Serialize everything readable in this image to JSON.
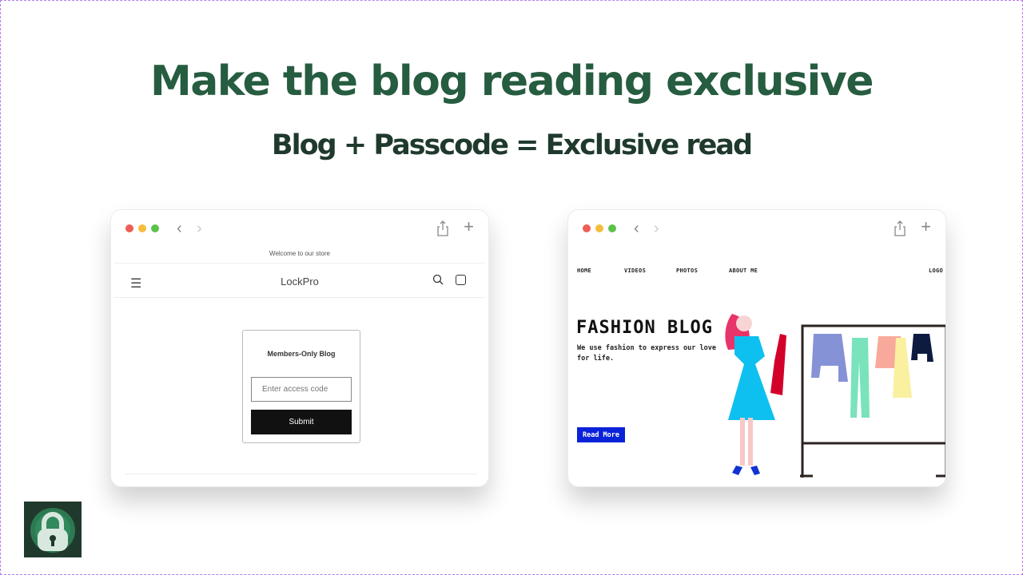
{
  "headline": "Make the blog reading exclusive",
  "subheadline": "Blog + Passcode = Exclusive read",
  "left_window": {
    "announcement": "Welcome to our store",
    "store_name": "LockPro",
    "icons": [
      "menu-icon",
      "search-icon",
      "cart-icon"
    ],
    "card": {
      "title": "Members-Only Blog",
      "input_placeholder": "Enter access code",
      "input_value": "",
      "submit_label": "Submit"
    }
  },
  "right_window": {
    "nav": [
      "HOME",
      "VIDEOS",
      "PHOTOS",
      "ABOUT ME"
    ],
    "logo": "LOGO",
    "hero_title": "FASHION BLOG",
    "hero_text": "We use fashion to express our love for life.",
    "cta_label": "Read More",
    "cta_color": "#0a22d9"
  },
  "browser": {
    "back": "‹",
    "forward": "›",
    "plus": "+"
  },
  "colors": {
    "headline": "#265c40",
    "subheadline": "#1f3a2d",
    "app_badge": "#1f3a2d"
  },
  "app_badge": {
    "icon": "padlock-icon"
  }
}
